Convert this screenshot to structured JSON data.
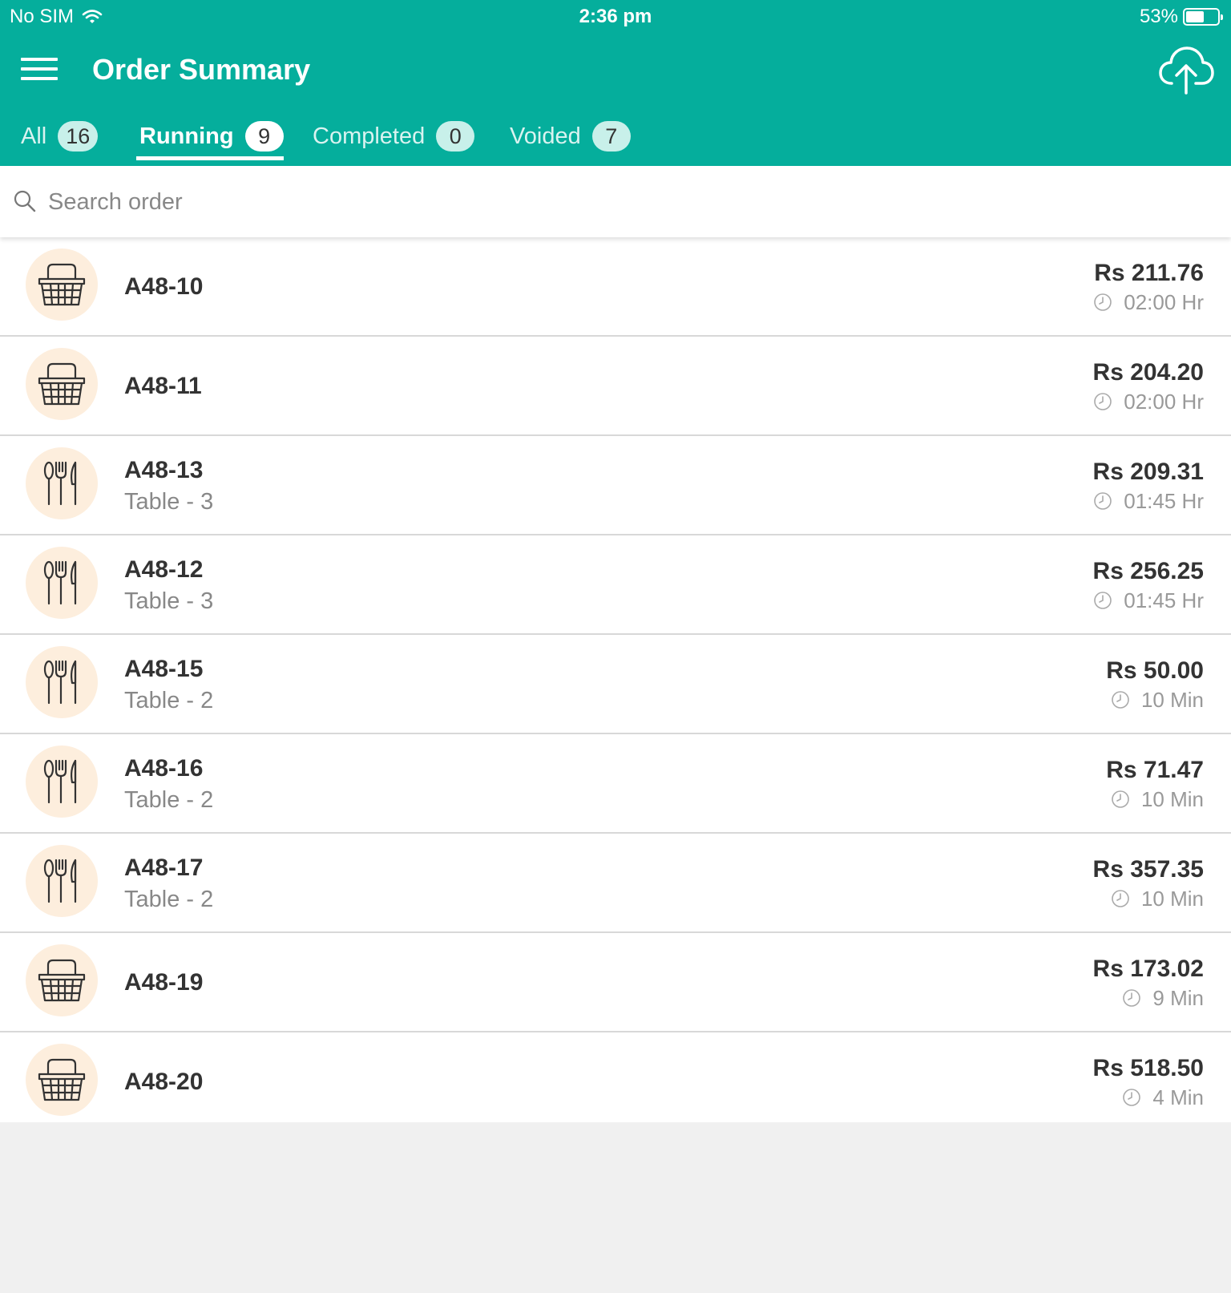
{
  "status_bar": {
    "carrier": "No SIM",
    "time": "2:36 pm",
    "battery": "53%"
  },
  "header": {
    "title": "Order Summary",
    "icons": {
      "menu": "hamburger-menu-icon",
      "upload": "cloud-upload-icon"
    }
  },
  "tabs": [
    {
      "label": "All",
      "count": "16",
      "active": false
    },
    {
      "label": "Running",
      "count": "9",
      "active": true
    },
    {
      "label": "Completed",
      "count": "0",
      "active": false
    },
    {
      "label": "Voided",
      "count": "7",
      "active": false
    }
  ],
  "search": {
    "placeholder": "Search order",
    "value": ""
  },
  "orders": [
    {
      "id": "A48-10",
      "table": "",
      "type": "basket",
      "amount": "Rs 211.76",
      "time": "02:00 Hr"
    },
    {
      "id": "A48-11",
      "table": "",
      "type": "basket",
      "amount": "Rs 204.20",
      "time": "02:00 Hr"
    },
    {
      "id": "A48-13",
      "table": "Table - 3",
      "type": "dine-in",
      "amount": "Rs 209.31",
      "time": "01:45 Hr"
    },
    {
      "id": "A48-12",
      "table": "Table - 3",
      "type": "dine-in",
      "amount": "Rs 256.25",
      "time": "01:45 Hr"
    },
    {
      "id": "A48-15",
      "table": "Table - 2",
      "type": "dine-in",
      "amount": "Rs 50.00",
      "time": "10 Min"
    },
    {
      "id": "A48-16",
      "table": "Table - 2",
      "type": "dine-in",
      "amount": "Rs 71.47",
      "time": "10 Min"
    },
    {
      "id": "A48-17",
      "table": "Table - 2",
      "type": "dine-in",
      "amount": "Rs 357.35",
      "time": "10 Min"
    },
    {
      "id": "A48-19",
      "table": "",
      "type": "basket",
      "amount": "Rs 173.02",
      "time": "9 Min"
    },
    {
      "id": "A48-20",
      "table": "",
      "type": "basket",
      "amount": "Rs 518.50",
      "time": "4 Min"
    }
  ],
  "colors": {
    "primary": "#05ae9c",
    "icon_bg": "#fdeedd",
    "list_bg": "#f0f0f0"
  }
}
